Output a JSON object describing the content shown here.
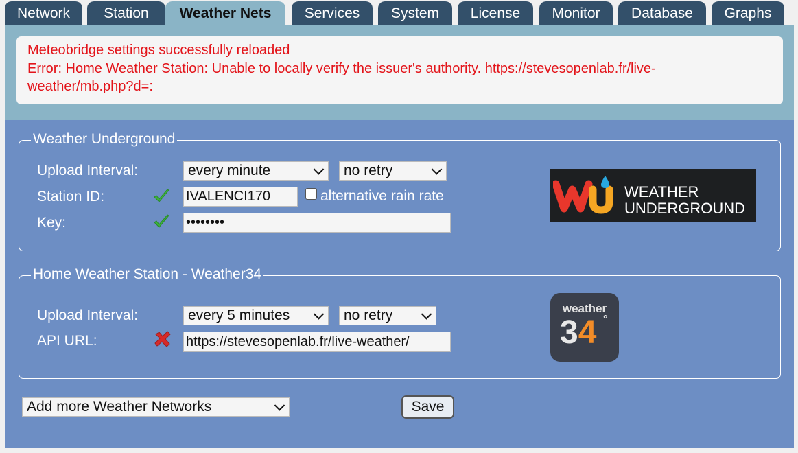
{
  "tabs": [
    "Network",
    "Station",
    "Weather Nets",
    "Services",
    "System",
    "License",
    "Monitor",
    "Database",
    "Graphs"
  ],
  "active_tab": "Weather Nets",
  "messages": {
    "line1": "Meteobridge settings successfully reloaded",
    "line2": "Error: Home Weather Station: Unable to locally verify the issuer's authority. https://stevesopenlab.fr/live-",
    "line3": "weather/mb.php?d=:"
  },
  "wu": {
    "legend": "Weather Underground",
    "upload_label": "Upload Interval:",
    "interval": "every minute",
    "retry": "no retry",
    "station_label": "Station ID:",
    "station_id": "IVALENCI170",
    "alt_rain_label": "alternative rain rate",
    "key_label": "Key:",
    "key_value": "••••••••",
    "logo_line1": "WEATHER",
    "logo_line2": "UNDERGROUND"
  },
  "hws": {
    "legend": "Home Weather Station - Weather34",
    "upload_label": "Upload Interval:",
    "interval": "every 5 minutes",
    "retry": "no retry",
    "api_label": "API URL:",
    "api_url": "https://stevesopenlab.fr/live-weather/",
    "logo_text": "weather",
    "logo_num3": "3",
    "logo_num4": "4",
    "logo_deg": "°"
  },
  "footer": {
    "add_more": "Add more Weather Networks",
    "save": "Save"
  },
  "colors": {
    "tab_bg": "#33506a",
    "active_tab_bg": "#8ab4c6",
    "error_text": "#e3141a",
    "panel_bg": "#6d8ec4",
    "check_green": "#3db43d",
    "cross_red": "#d62a2a"
  },
  "icons": {
    "valid": "green-check-icon",
    "invalid": "red-cross-icon"
  }
}
